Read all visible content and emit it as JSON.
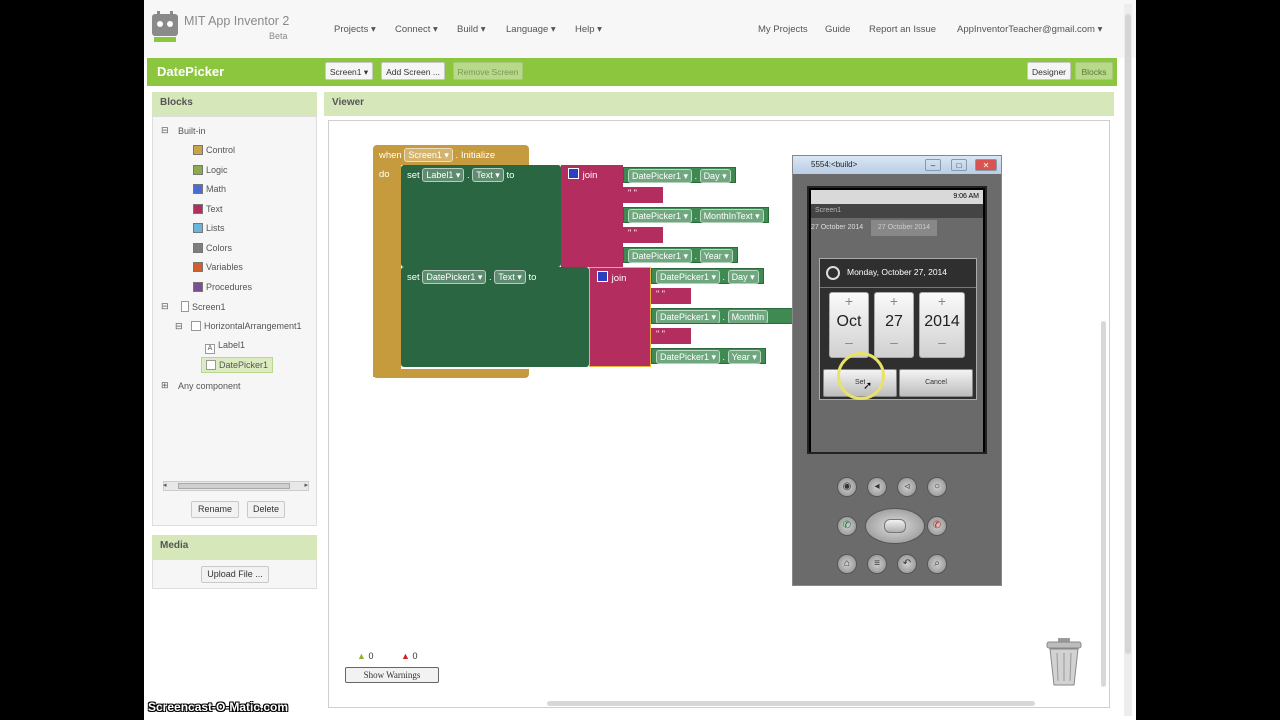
{
  "app": {
    "title": "MIT App Inventor 2",
    "subtitle": "Beta"
  },
  "topnav": {
    "menus": [
      "Projects ▾",
      "Connect ▾",
      "Build ▾",
      "Language ▾",
      "Help ▾"
    ],
    "right": [
      "My Projects",
      "Guide",
      "Report an Issue",
      "AppInventorTeacher@gmail.com ▾"
    ]
  },
  "toolbar": {
    "project_name": "DatePicker",
    "screen_select": "Screen1 ▾",
    "add_screen": "Add Screen ...",
    "remove_screen": "Remove Screen",
    "designer": "Designer",
    "blocks": "Blocks"
  },
  "blocks_panel": {
    "header": "Blocks",
    "builtin_label": "Built-in",
    "builtin": [
      {
        "label": "Control",
        "color": "#c9a24b"
      },
      {
        "label": "Logic",
        "color": "#8bab4c"
      },
      {
        "label": "Math",
        "color": "#4a6cd4"
      },
      {
        "label": "Text",
        "color": "#b32d5e"
      },
      {
        "label": "Lists",
        "color": "#6ab4db"
      },
      {
        "label": "Colors",
        "color": "#7d7d7d"
      },
      {
        "label": "Variables",
        "color": "#d05f2d"
      },
      {
        "label": "Procedures",
        "color": "#7b4f94"
      }
    ],
    "screen": "Screen1",
    "arrangement": "HorizontalArrangement1",
    "label1": "Label1",
    "datepicker1": "DatePicker1",
    "any_component": "Any component",
    "rename": "Rename",
    "delete": "Delete"
  },
  "media": {
    "header": "Media",
    "upload": "Upload File ..."
  },
  "viewer": {
    "header": "Viewer",
    "warnings_count": "0",
    "errors_count": "0",
    "show_warnings": "Show Warnings"
  },
  "event_block": {
    "when": "when",
    "component": "Screen1 ▾",
    "event": ". Initialize",
    "do": "do",
    "set": "set",
    "to": "to",
    "join": "join",
    "set1_component": "Label1 ▾",
    "set1_property": "Text ▾",
    "set2_component": "DatePicker1 ▾",
    "set2_property": "Text ▾",
    "join1": [
      {
        "comp": "DatePicker1 ▾",
        "prop": "Day ▾"
      },
      {
        "comp": "DatePicker1 ▾",
        "prop": "MonthInText ▾"
      },
      {
        "comp": "DatePicker1 ▾",
        "prop": "Year ▾"
      }
    ],
    "join2": [
      {
        "comp": "DatePicker1 ▾",
        "prop": "Day ▾"
      },
      {
        "comp": "DatePicker1 ▾",
        "prop": "MonthIn"
      },
      {
        "comp": "DatePicker1 ▾",
        "prop": "Year ▾"
      }
    ],
    "quote": "\" \""
  },
  "emulator": {
    "window_title": "5554:<build>",
    "clock": "9:06 AM",
    "app_title": "Screen1",
    "label_text": "27 October 2014",
    "button_text": "27 October 2014",
    "dialog_title": "Monday, October 27, 2014",
    "month": "Oct",
    "day": "27",
    "year": "2014",
    "set": "Set",
    "cancel": "Cancel"
  },
  "watermark": "Screencast-O-Matic.com"
}
